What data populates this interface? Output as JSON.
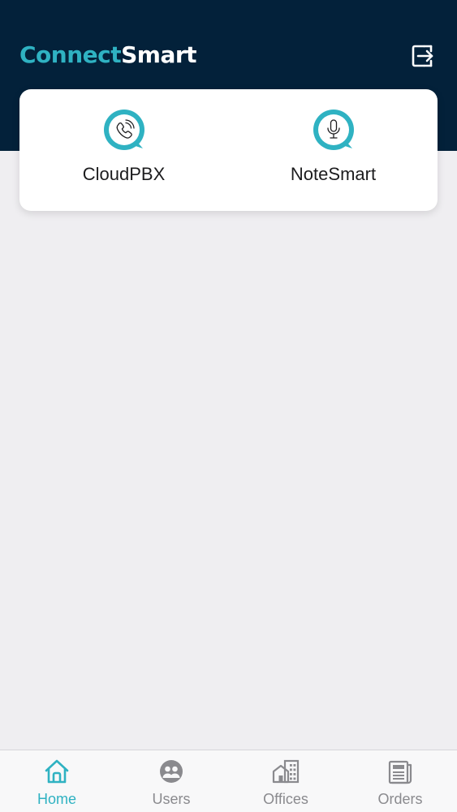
{
  "header": {
    "logo_part1": "Connect",
    "logo_part2": "Smart",
    "logout_icon": "logout-icon"
  },
  "apps": [
    {
      "label": "CloudPBX",
      "icon": "phone-icon"
    },
    {
      "label": "NoteSmart",
      "icon": "microphone-icon"
    }
  ],
  "tabs": [
    {
      "label": "Home",
      "icon": "home-icon",
      "active": true
    },
    {
      "label": "Users",
      "icon": "users-icon",
      "active": false
    },
    {
      "label": "Offices",
      "icon": "offices-icon",
      "active": false
    },
    {
      "label": "Orders",
      "icon": "orders-icon",
      "active": false
    }
  ],
  "colors": {
    "header_bg": "#03213a",
    "accent": "#2fb2c2",
    "page_bg": "#efeef1",
    "tab_inactive": "#8a8a8e"
  }
}
